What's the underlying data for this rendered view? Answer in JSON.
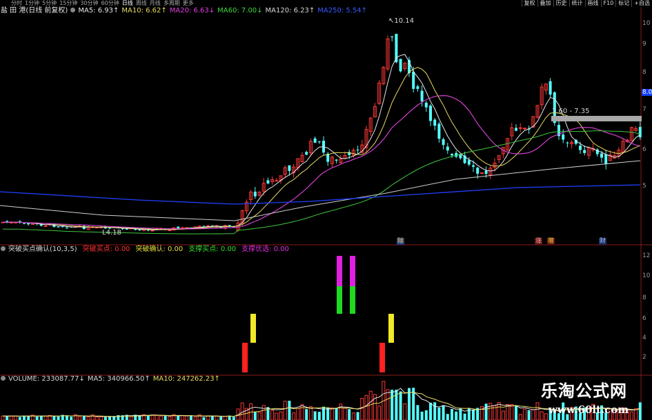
{
  "toolbar": {
    "stock_title": "盐 田 港(日线 前复权)",
    "periods": [
      "分时",
      "1分钟",
      "5分钟",
      "15分钟",
      "30分钟",
      "60分钟",
      "日线",
      "周线",
      "月线",
      "多周期",
      "更多"
    ],
    "active_period": "日线",
    "right_buttons": [
      "复权",
      "叠加",
      "历史",
      "统计",
      "画线",
      "F10",
      "标记",
      "+自选"
    ]
  },
  "price_panel": {
    "ma": [
      {
        "label": "MA5: 6.93",
        "arrow": "↑",
        "color": "#e8e8e8"
      },
      {
        "label": "MA10: 6.62",
        "arrow": "↑",
        "color": "#e8dc60"
      },
      {
        "label": "MA20: 6.63",
        "arrow": "↓",
        "color": "#e040e0"
      },
      {
        "label": "MA60: 7.00",
        "arrow": "↓",
        "color": "#40d840"
      },
      {
        "label": "MA120: 6.23",
        "arrow": "↑",
        "color": "#d8d8d8"
      },
      {
        "label": "MA250: 5.54",
        "arrow": "↑",
        "color": "#3858ff"
      }
    ],
    "high_label": "10.14",
    "low_label": "4.18",
    "range_label": "7.60 - 7.35",
    "axis": [
      "10",
      "9",
      "8",
      "7",
      "6",
      "5"
    ],
    "axis_tag": "8.0",
    "event_tags": [
      "除",
      "涨",
      "赠",
      "财"
    ]
  },
  "indicator_panel": {
    "name": "突破买点确认(10,3,5)",
    "items": [
      {
        "label": "突破买点: 0.00",
        "color": "#ff3030"
      },
      {
        "label": "突破确认: 0.00",
        "color": "#e8e040"
      },
      {
        "label": "支撑买点: 0.00",
        "color": "#30e030"
      },
      {
        "label": "支撑优选: 0.00",
        "color": "#e030e0"
      }
    ],
    "axis": [
      "12",
      "10",
      "8",
      "6",
      "4",
      "2"
    ]
  },
  "volume_panel": {
    "items": [
      {
        "label": "VOLUME: 233087.77",
        "arrow": "↓",
        "color": "#d8d8d8"
      },
      {
        "label": "MA5: 340966.50",
        "arrow": "↑",
        "color": "#d8d8d8"
      },
      {
        "label": "MA10: 247262.23",
        "arrow": "↑",
        "color": "#e8dc60"
      }
    ]
  },
  "watermark": {
    "title": "乐淘公式网",
    "url": "www.60lt.com"
  }
}
